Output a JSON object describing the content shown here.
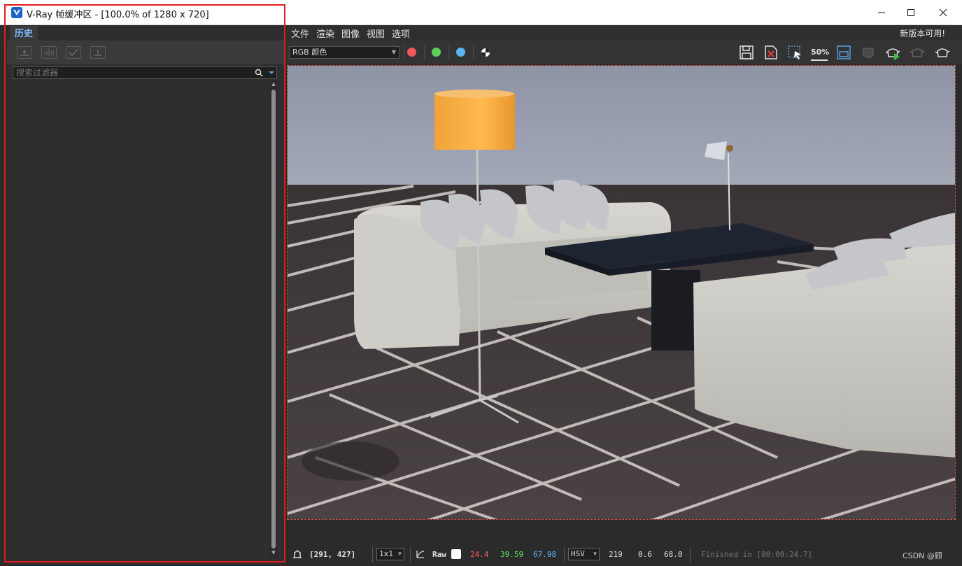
{
  "window": {
    "title": "V-Ray 帧缓冲区 - [100.0% of 1280 x 720]"
  },
  "history_panel": {
    "tab_label": "历史",
    "search": {
      "placeholder": "搜索过滤器",
      "value": ""
    }
  },
  "menu": {
    "items": [
      "文件",
      "渲染",
      "图像",
      "视图",
      "选项"
    ],
    "update_notice": "新版本可用!"
  },
  "toolbar": {
    "channel": "RGB 颜色",
    "color_dots": [
      "#f05a5a",
      "#5ad25a",
      "#5ab4f0"
    ],
    "test_resolution_label": "50%"
  },
  "status": {
    "coords": "[291, 427]",
    "zoom": "1x1",
    "mode": "Raw",
    "r": "24.4",
    "g": "39.59",
    "b": "67.98",
    "color_space": "HSV",
    "h": "219",
    "s": "0.6",
    "v": "68.0",
    "finished": "Finished in [00:00:24.7]",
    "watermark": "CSDN @顾"
  },
  "colors": {
    "r": "#ff5a5a",
    "g": "#5ae05a",
    "b": "#5ab4ff",
    "accent": "#7fb8ff",
    "highlight_frame": "#e31b1b"
  }
}
